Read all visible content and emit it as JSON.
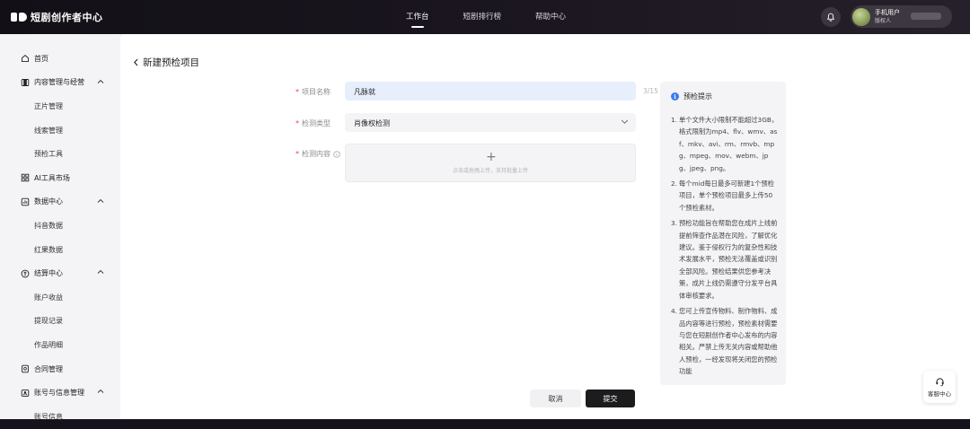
{
  "app": {
    "logo_text": "短剧创作者中心"
  },
  "topnav": [
    {
      "label": "工作台",
      "active": true
    },
    {
      "label": "短剧排行榜",
      "active": false
    },
    {
      "label": "帮助中心",
      "active": false
    }
  ],
  "user": {
    "name": "手机用户",
    "role": "版权人"
  },
  "sidebar": {
    "items": [
      {
        "label": "首页",
        "icon": "home-icon"
      },
      {
        "label": "内容管理与经营",
        "icon": "content-icon",
        "children": [
          "正片管理",
          "线索管理",
          "预检工具"
        ]
      },
      {
        "label": "AI工具市场",
        "icon": "grid-icon"
      },
      {
        "label": "数据中心",
        "icon": "data-icon",
        "children": [
          "抖音数据",
          "红果数据"
        ]
      },
      {
        "label": "结算中心",
        "icon": "settlement-icon",
        "children": [
          "账户收益",
          "提现记录",
          "作品明细"
        ]
      },
      {
        "label": "合同管理",
        "icon": "contract-icon"
      },
      {
        "label": "账号与信息管理",
        "icon": "account-icon",
        "children": [
          "账号信息"
        ]
      }
    ]
  },
  "page": {
    "title": "新建预检项目"
  },
  "form": {
    "name": {
      "label": "项目名称",
      "value": "凡脉就",
      "counter": "3/15"
    },
    "type": {
      "label": "检测类型",
      "value": "肖像权检测"
    },
    "content": {
      "label": "检测内容",
      "upload_hint": "点击或拖拽上传，支持批量上传"
    }
  },
  "tips": {
    "title": "预检提示",
    "items": [
      {
        "num": "1.",
        "text": "单个文件大小限制不能超过3GB，格式限制为mp4、flv、wmv、asf、mkv、avi、rm、rmvb、mpg、mpeg、mov、webm、jpg、jpeg、png。"
      },
      {
        "num": "2.",
        "text": "每个mid每日最多可新建1个预检项目，单个预检项目最多上传50个预检素材。"
      },
      {
        "num": "3.",
        "text": "预检功能旨在帮助您在成片上线前提前筛查作品潜在风险，了解优化建议。鉴于侵权行为的复杂性和技术发展水平，预检无法覆盖或识别全部风险。预检结果供您参考决策，成片上线仍需遵守分发平台具体审核要求。"
      },
      {
        "num": "4.",
        "text": "您可上传宣传物料、制作物料、成品内容等进行预检，预检素材需要与您在短剧创作者中心发布的内容相关。严禁上传无关内容或帮助他人预检，一经发现将关闭您的预检功能"
      }
    ]
  },
  "actions": {
    "cancel": "取消",
    "submit": "提交"
  },
  "support": {
    "label": "客服中心"
  }
}
